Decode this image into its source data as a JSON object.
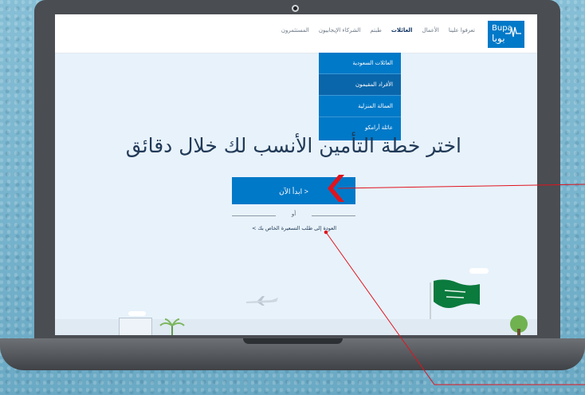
{
  "navbar": {
    "logo": {
      "latin": "Bupa",
      "arabic": "بوبا"
    },
    "items": [
      {
        "label": "تعرفوا علينا",
        "active": false
      },
      {
        "label": "الأعمال",
        "active": false
      },
      {
        "label": "العائلات",
        "active": true
      },
      {
        "label": "طبتم",
        "active": false
      },
      {
        "label": "الشركاء الإيجابيون",
        "active": false
      },
      {
        "label": "المستثمرون",
        "active": false
      }
    ]
  },
  "dropdown": {
    "items": [
      {
        "label": "العائلات السعودية"
      },
      {
        "label": "الأفراد المقيمون"
      },
      {
        "label": "العمالة المنزلية"
      },
      {
        "label": "عائلة أرامكو"
      }
    ]
  },
  "hero": {
    "title": "اختر خطة التأمين الأنسب لك خلال دقائق",
    "start_button": "ابدأ الآن >",
    "or_text": "أو",
    "back_link": "العودة إلى طلب التسعيرة الخاص بك >"
  },
  "colors": {
    "brand": "#0079c8",
    "annotation": "#e0141e",
    "title": "#213a57"
  }
}
